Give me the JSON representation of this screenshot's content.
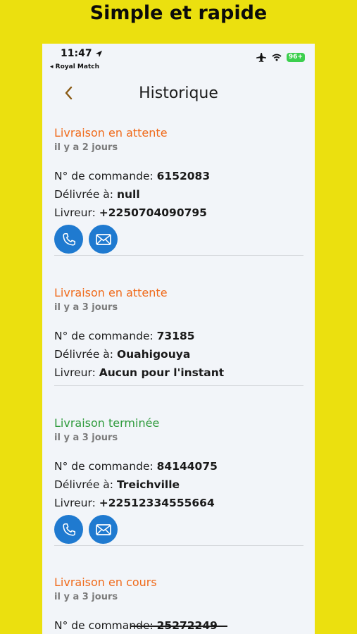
{
  "banner": {
    "title": "Simple et rapide"
  },
  "status_bar": {
    "time": "11:47",
    "back_app": "◂ Royal Match",
    "battery": "96+"
  },
  "header": {
    "title": "Historique"
  },
  "labels": {
    "order_number": "N° de commande: ",
    "delivered_to": "Délivrée à: ",
    "courier": "Livreur: "
  },
  "orders": [
    {
      "status": "Livraison en attente",
      "when": "il y a 2 jours",
      "order_number": "6152083",
      "delivered_to": "null",
      "courier": "+2250704090795",
      "has_contact": true
    },
    {
      "status": "Livraison en attente",
      "when": "il y a 3 jours",
      "order_number": "73185",
      "delivered_to": "Ouahigouya",
      "courier": "Aucun pour l'instant",
      "has_contact": false
    },
    {
      "status": "Livraison terminée",
      "when": "il y a 3 jours",
      "order_number": "84144075",
      "delivered_to": "Treichville",
      "courier": "+22512334555664",
      "has_contact": true
    },
    {
      "status": "Livraison en cours",
      "when": "il y a 3 jours",
      "order_number": "25272249",
      "delivered_to": "",
      "courier": "",
      "has_contact": false
    }
  ],
  "colors": {
    "pending": "#f06a1a",
    "done": "#2d9a3a",
    "action": "#1f7ad0",
    "background": "#ebe00f"
  }
}
